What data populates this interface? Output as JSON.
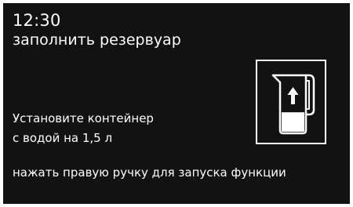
{
  "status": {
    "time": "12:30",
    "title": "заполнить резервуар"
  },
  "instruction": {
    "lines": [
      "Установите контейнер",
      "с водой на 1,5 л"
    ]
  },
  "hint": "нажать правую ручку для запуска функции",
  "icon": {
    "name": "water-jug-fill-icon",
    "fill_fraction": 0.4
  },
  "colors": {
    "background": "#121212",
    "foreground": "#ffffff"
  }
}
